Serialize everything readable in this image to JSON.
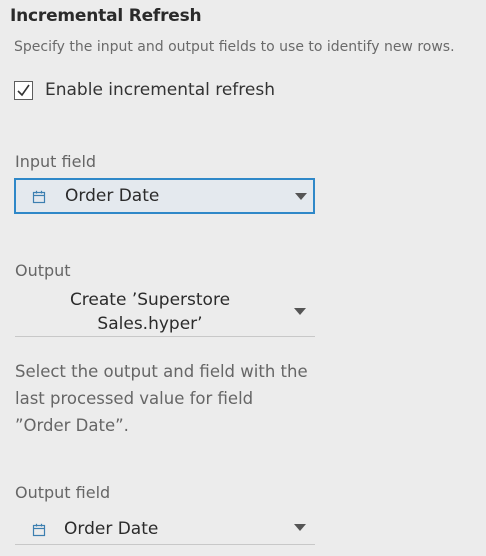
{
  "panel": {
    "title": "Incremental Refresh",
    "subtitle": "Specify the input and output fields to use to identify new rows."
  },
  "enable_checkbox": {
    "label": "Enable incremental refresh",
    "checked": true
  },
  "input_field": {
    "label": "Input field",
    "selected": "Order Date",
    "icon": "calendar-icon"
  },
  "output": {
    "label": "Output",
    "selected_line1": "Create ’Superstore",
    "selected_line2": "Sales.hyper’"
  },
  "description": {
    "line1": "Select the output and field with the",
    "line2": "last processed value for field",
    "line3": "”Order Date”."
  },
  "output_field": {
    "label": "Output field",
    "selected": "Order Date",
    "icon": "calendar-icon"
  },
  "colors": {
    "background": "#ececec",
    "accent_border": "#2f88c8",
    "icon": "#3c7fb0",
    "muted_text": "#666666"
  }
}
